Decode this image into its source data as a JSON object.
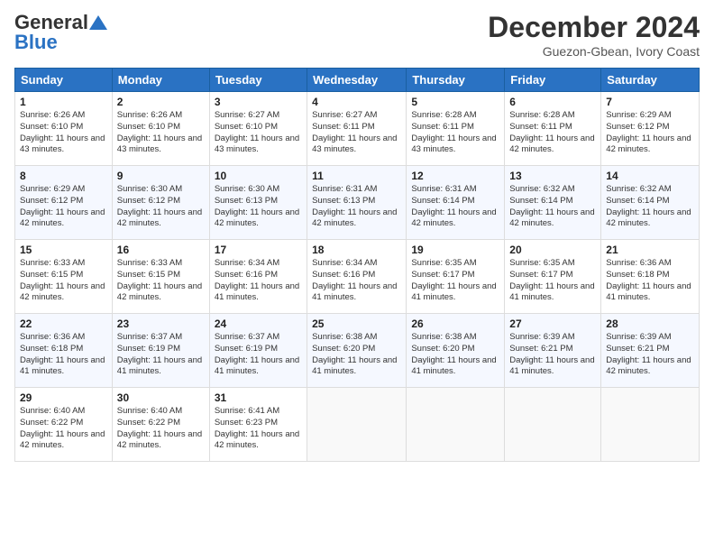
{
  "logo": {
    "general": "General",
    "blue": "Blue"
  },
  "title": "December 2024",
  "location": "Guezon-Gbean, Ivory Coast",
  "days_header": [
    "Sunday",
    "Monday",
    "Tuesday",
    "Wednesday",
    "Thursday",
    "Friday",
    "Saturday"
  ],
  "weeks": [
    [
      {
        "day": "1",
        "sunrise": "Sunrise: 6:26 AM",
        "sunset": "Sunset: 6:10 PM",
        "daylight": "Daylight: 11 hours and 43 minutes."
      },
      {
        "day": "2",
        "sunrise": "Sunrise: 6:26 AM",
        "sunset": "Sunset: 6:10 PM",
        "daylight": "Daylight: 11 hours and 43 minutes."
      },
      {
        "day": "3",
        "sunrise": "Sunrise: 6:27 AM",
        "sunset": "Sunset: 6:10 PM",
        "daylight": "Daylight: 11 hours and 43 minutes."
      },
      {
        "day": "4",
        "sunrise": "Sunrise: 6:27 AM",
        "sunset": "Sunset: 6:11 PM",
        "daylight": "Daylight: 11 hours and 43 minutes."
      },
      {
        "day": "5",
        "sunrise": "Sunrise: 6:28 AM",
        "sunset": "Sunset: 6:11 PM",
        "daylight": "Daylight: 11 hours and 43 minutes."
      },
      {
        "day": "6",
        "sunrise": "Sunrise: 6:28 AM",
        "sunset": "Sunset: 6:11 PM",
        "daylight": "Daylight: 11 hours and 42 minutes."
      },
      {
        "day": "7",
        "sunrise": "Sunrise: 6:29 AM",
        "sunset": "Sunset: 6:12 PM",
        "daylight": "Daylight: 11 hours and 42 minutes."
      }
    ],
    [
      {
        "day": "8",
        "sunrise": "Sunrise: 6:29 AM",
        "sunset": "Sunset: 6:12 PM",
        "daylight": "Daylight: 11 hours and 42 minutes."
      },
      {
        "day": "9",
        "sunrise": "Sunrise: 6:30 AM",
        "sunset": "Sunset: 6:12 PM",
        "daylight": "Daylight: 11 hours and 42 minutes."
      },
      {
        "day": "10",
        "sunrise": "Sunrise: 6:30 AM",
        "sunset": "Sunset: 6:13 PM",
        "daylight": "Daylight: 11 hours and 42 minutes."
      },
      {
        "day": "11",
        "sunrise": "Sunrise: 6:31 AM",
        "sunset": "Sunset: 6:13 PM",
        "daylight": "Daylight: 11 hours and 42 minutes."
      },
      {
        "day": "12",
        "sunrise": "Sunrise: 6:31 AM",
        "sunset": "Sunset: 6:14 PM",
        "daylight": "Daylight: 11 hours and 42 minutes."
      },
      {
        "day": "13",
        "sunrise": "Sunrise: 6:32 AM",
        "sunset": "Sunset: 6:14 PM",
        "daylight": "Daylight: 11 hours and 42 minutes."
      },
      {
        "day": "14",
        "sunrise": "Sunrise: 6:32 AM",
        "sunset": "Sunset: 6:14 PM",
        "daylight": "Daylight: 11 hours and 42 minutes."
      }
    ],
    [
      {
        "day": "15",
        "sunrise": "Sunrise: 6:33 AM",
        "sunset": "Sunset: 6:15 PM",
        "daylight": "Daylight: 11 hours and 42 minutes."
      },
      {
        "day": "16",
        "sunrise": "Sunrise: 6:33 AM",
        "sunset": "Sunset: 6:15 PM",
        "daylight": "Daylight: 11 hours and 42 minutes."
      },
      {
        "day": "17",
        "sunrise": "Sunrise: 6:34 AM",
        "sunset": "Sunset: 6:16 PM",
        "daylight": "Daylight: 11 hours and 41 minutes."
      },
      {
        "day": "18",
        "sunrise": "Sunrise: 6:34 AM",
        "sunset": "Sunset: 6:16 PM",
        "daylight": "Daylight: 11 hours and 41 minutes."
      },
      {
        "day": "19",
        "sunrise": "Sunrise: 6:35 AM",
        "sunset": "Sunset: 6:17 PM",
        "daylight": "Daylight: 11 hours and 41 minutes."
      },
      {
        "day": "20",
        "sunrise": "Sunrise: 6:35 AM",
        "sunset": "Sunset: 6:17 PM",
        "daylight": "Daylight: 11 hours and 41 minutes."
      },
      {
        "day": "21",
        "sunrise": "Sunrise: 6:36 AM",
        "sunset": "Sunset: 6:18 PM",
        "daylight": "Daylight: 11 hours and 41 minutes."
      }
    ],
    [
      {
        "day": "22",
        "sunrise": "Sunrise: 6:36 AM",
        "sunset": "Sunset: 6:18 PM",
        "daylight": "Daylight: 11 hours and 41 minutes."
      },
      {
        "day": "23",
        "sunrise": "Sunrise: 6:37 AM",
        "sunset": "Sunset: 6:19 PM",
        "daylight": "Daylight: 11 hours and 41 minutes."
      },
      {
        "day": "24",
        "sunrise": "Sunrise: 6:37 AM",
        "sunset": "Sunset: 6:19 PM",
        "daylight": "Daylight: 11 hours and 41 minutes."
      },
      {
        "day": "25",
        "sunrise": "Sunrise: 6:38 AM",
        "sunset": "Sunset: 6:20 PM",
        "daylight": "Daylight: 11 hours and 41 minutes."
      },
      {
        "day": "26",
        "sunrise": "Sunrise: 6:38 AM",
        "sunset": "Sunset: 6:20 PM",
        "daylight": "Daylight: 11 hours and 41 minutes."
      },
      {
        "day": "27",
        "sunrise": "Sunrise: 6:39 AM",
        "sunset": "Sunset: 6:21 PM",
        "daylight": "Daylight: 11 hours and 41 minutes."
      },
      {
        "day": "28",
        "sunrise": "Sunrise: 6:39 AM",
        "sunset": "Sunset: 6:21 PM",
        "daylight": "Daylight: 11 hours and 42 minutes."
      }
    ],
    [
      {
        "day": "29",
        "sunrise": "Sunrise: 6:40 AM",
        "sunset": "Sunset: 6:22 PM",
        "daylight": "Daylight: 11 hours and 42 minutes."
      },
      {
        "day": "30",
        "sunrise": "Sunrise: 6:40 AM",
        "sunset": "Sunset: 6:22 PM",
        "daylight": "Daylight: 11 hours and 42 minutes."
      },
      {
        "day": "31",
        "sunrise": "Sunrise: 6:41 AM",
        "sunset": "Sunset: 6:23 PM",
        "daylight": "Daylight: 11 hours and 42 minutes."
      },
      null,
      null,
      null,
      null
    ]
  ]
}
